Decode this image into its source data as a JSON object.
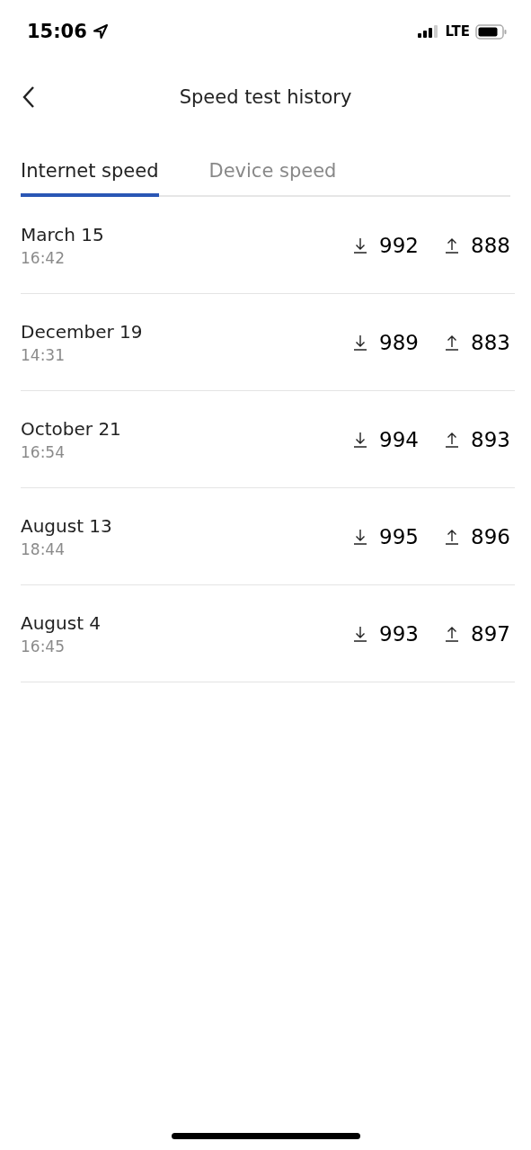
{
  "status_bar": {
    "time": "15:06",
    "network": "LTE"
  },
  "header": {
    "title": "Speed test history"
  },
  "tabs": [
    {
      "label": "Internet speed",
      "selected": true
    },
    {
      "label": "Device speed",
      "selected": false
    }
  ],
  "rows": [
    {
      "date": "March 15",
      "time": "16:42",
      "download": "992",
      "upload": "888"
    },
    {
      "date": "December 19",
      "time": "14:31",
      "download": "989",
      "upload": "883"
    },
    {
      "date": "October 21",
      "time": "16:54",
      "download": "994",
      "upload": "893"
    },
    {
      "date": "August 13",
      "time": "18:44",
      "download": "995",
      "upload": "896"
    },
    {
      "date": "August 4",
      "time": "16:45",
      "download": "993",
      "upload": "897"
    }
  ]
}
